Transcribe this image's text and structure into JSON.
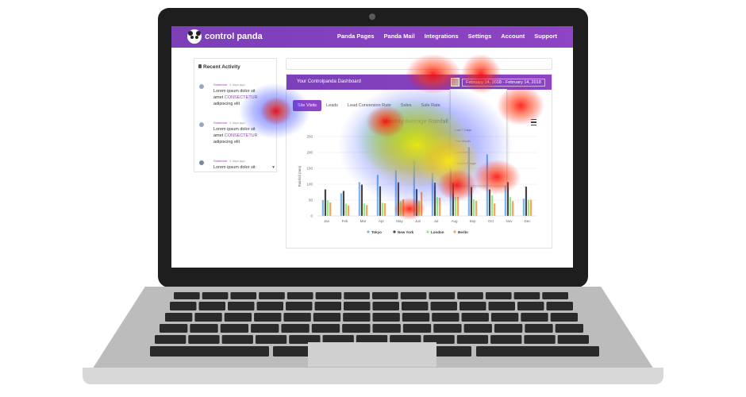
{
  "app": {
    "brand": "control panda",
    "nav": [
      "Panda Pages",
      "Panda Mail",
      "Integrations",
      "Settings",
      "Account",
      "Support"
    ]
  },
  "recent_activity": {
    "title": "Recent Activity",
    "items": [
      {
        "user": "Someone",
        "time": "4 days ago",
        "text": "Lorem ipsum dolor sit amet",
        "link": "CONSECTETUR",
        "text2": "adipiscing elit"
      },
      {
        "user": "Someone",
        "time": "4 days ago",
        "text": "Lorem ipsum dolor sit amet",
        "link": "CONSECTETUR",
        "text2": "adipiscing elit"
      },
      {
        "user": "Someone",
        "time": "4 days ago",
        "text": "Lorem ipsum dolor sit"
      }
    ]
  },
  "dashboard": {
    "title": "Your Controlpanda Dashboard",
    "date_range": "February 14, 2018 - February 14, 2018",
    "tabs": [
      "Site Visits",
      "Leads",
      "Lead Conversion Rate",
      "Sales",
      "Sale Rate"
    ],
    "active_tab": "Site Visits",
    "dropdown_items": [
      "Last 7 Days",
      "This Month",
      "Last Month",
      "Custom Range"
    ]
  },
  "colors": {
    "accent": "#8e44c4",
    "tokyo": "#7cb5ec",
    "new_york": "#434348",
    "london": "#90ed7d",
    "berlin": "#f7a35c"
  },
  "chart_data": {
    "type": "bar",
    "title": "Monthly Average Rainfall",
    "ylabel": "Rainfall (mm)",
    "categories": [
      "Jan",
      "Feb",
      "Mar",
      "Apr",
      "May",
      "Jun",
      "Jul",
      "Aug",
      "Sep",
      "Oct",
      "Nov",
      "Dec"
    ],
    "ylim": [
      0,
      250
    ],
    "yticks": [
      0,
      50,
      100,
      150,
      200,
      250
    ],
    "series": [
      {
        "name": "Tokyo",
        "values": [
          49.9,
          71.5,
          106.4,
          129.2,
          144.0,
          176.0,
          135.6,
          148.5,
          216.4,
          194.1,
          95.6,
          54.4
        ]
      },
      {
        "name": "New York",
        "values": [
          83.6,
          78.8,
          98.5,
          93.4,
          106.0,
          84.5,
          105.0,
          104.3,
          91.2,
          83.5,
          106.6,
          92.3
        ]
      },
      {
        "name": "London",
        "values": [
          48.9,
          38.8,
          39.3,
          41.4,
          47.0,
          48.3,
          59.0,
          59.6,
          52.4,
          65.2,
          59.3,
          51.2
        ]
      },
      {
        "name": "Berlin",
        "values": [
          42.4,
          33.2,
          34.5,
          39.7,
          52.6,
          75.5,
          57.4,
          60.4,
          47.6,
          39.1,
          46.8,
          51.1
        ]
      }
    ],
    "legend": "bottom-center"
  }
}
